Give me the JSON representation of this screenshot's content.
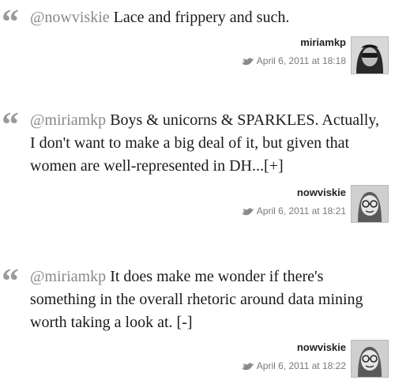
{
  "tweets": [
    {
      "mention": "@nowviskie",
      "text": " Lace and frippery and such.",
      "toggle": "",
      "user": "miriamkp",
      "timestamp": "April 6, 2011 at 18:18",
      "avatar": "photo-avatar"
    },
    {
      "mention": "@miriamkp",
      "text": " Boys & unicorns & SPARKLES. Actually, I don't want to make a big deal of it, but given that women are well-represented in DH...",
      "toggle": "[+]",
      "user": "nowviskie",
      "timestamp": "April 6, 2011 at 18:21",
      "avatar": "cartoon-avatar"
    },
    {
      "mention": "@miriamkp",
      "text": " It does make me wonder if there's something in the overall rhetoric around data mining worth taking a look at. ",
      "toggle": "[-]",
      "user": "nowviskie",
      "timestamp": "April 6, 2011 at 18:22",
      "avatar": "cartoon-avatar"
    }
  ],
  "quote_glyph": "“",
  "icons": {
    "quote": "quote-icon",
    "bird": "twitter-bird-icon"
  },
  "colors": {
    "mention": "#888888",
    "quote": "#9a9a9a",
    "timestamp": "#7a7a7a"
  }
}
